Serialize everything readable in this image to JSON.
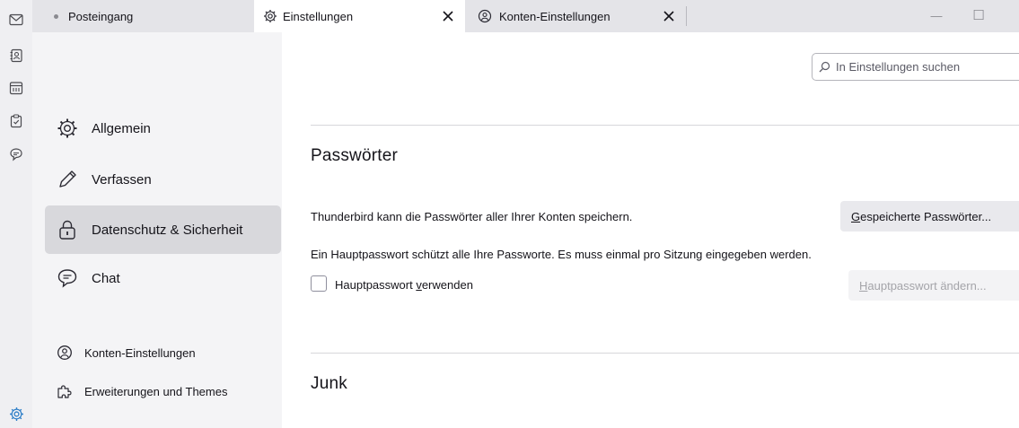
{
  "tabs": [
    {
      "title": "Posteingang",
      "icon": "dot-icon",
      "selected": false
    },
    {
      "title": "Einstellungen",
      "icon": "gear-icon",
      "selected": true
    },
    {
      "title": "Konten-Einstellungen",
      "icon": "account-settings-icon",
      "selected": false
    }
  ],
  "window": {
    "minimize": "—",
    "maximize": "☐"
  },
  "spaces": [
    "mail-icon",
    "address-book-icon",
    "calendar-icon",
    "tasks-icon",
    "chat-icon",
    "settings-icon"
  ],
  "search": {
    "placeholder": "In Einstellungen suchen"
  },
  "categories": [
    {
      "label": "Allgemein",
      "icon": "gear-icon",
      "selected": false
    },
    {
      "label": "Verfassen",
      "icon": "pencil-icon",
      "selected": false
    },
    {
      "label": "Datenschutz & Sicherheit",
      "icon": "lock-icon",
      "selected": true
    },
    {
      "label": "Chat",
      "icon": "chat-icon",
      "selected": false
    }
  ],
  "footer": [
    {
      "label": "Konten-Einstellungen",
      "icon": "account-settings-icon"
    },
    {
      "label": "Erweiterungen und Themes",
      "icon": "puzzle-icon"
    }
  ],
  "passwords": {
    "heading": "Passwörter",
    "description": "Thunderbird kann die Passwörter aller Ihrer Konten speichern.",
    "saved_button": {
      "accesskey": "G",
      "rest": "espeicherte Passwörter..."
    },
    "primary_description": "Ein Hauptpasswort schützt alle Ihre Passworte. Es muss einmal pro Sitzung eingegeben werden.",
    "use_primary": {
      "before": "Hauptpasswort ",
      "accesskey": "v",
      "after": "erwenden",
      "checked": false
    },
    "change_button": {
      "accesskey": "H",
      "rest": "auptpasswort ändern..."
    }
  },
  "junk": {
    "heading": "Junk"
  }
}
